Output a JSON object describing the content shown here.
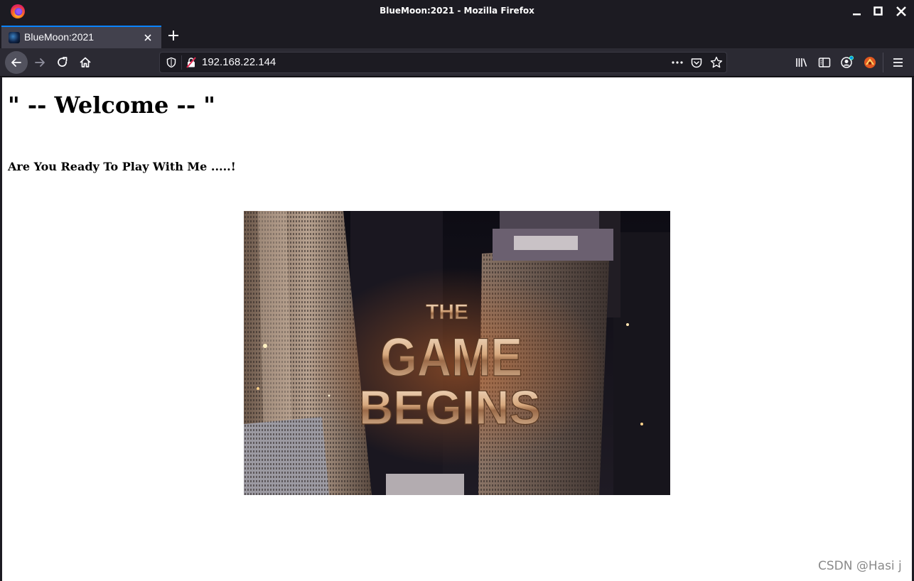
{
  "window": {
    "title": "BlueMoon:2021 - Mozilla Firefox"
  },
  "tabs": [
    {
      "label": "BlueMoon:2021",
      "active": true
    }
  ],
  "address_bar": {
    "url": "192.168.22.144"
  },
  "page": {
    "heading": "\" -- Welcome -- \"",
    "subheading": "Are You Ready To Play With Me .....!",
    "hero_image": {
      "line1": "THE",
      "line2": "GAME",
      "line3": "BEGINS"
    }
  },
  "watermark": "CSDN @Hasi j",
  "colors": {
    "chrome_dark": "#1c1b22",
    "toolbar": "#2b2a33",
    "tab_active": "#42414d",
    "tab_accent": "#0a84ff",
    "page_bg": "#ffffff"
  },
  "icons": [
    "firefox-logo-icon",
    "minimize-icon",
    "maximize-icon",
    "close-icon",
    "tab-close-icon",
    "new-tab-icon",
    "back-icon",
    "forward-icon",
    "reload-icon",
    "home-icon",
    "tracking-shield-icon",
    "insecure-lock-icon",
    "page-actions-icon",
    "pocket-icon",
    "bookmark-star-icon",
    "library-icon",
    "sidebar-icon",
    "account-icon",
    "extension-icon",
    "menu-icon"
  ]
}
